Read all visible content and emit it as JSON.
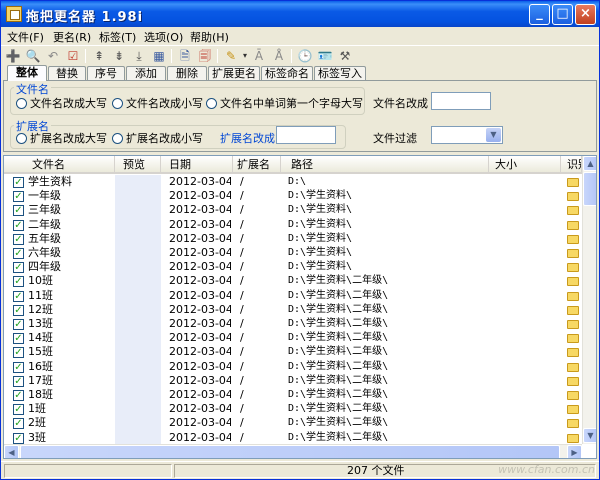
{
  "window": {
    "title": "拖把更名器 1.98i",
    "buttons": {
      "minimize": "_",
      "maximize": "□",
      "close": "×"
    }
  },
  "menu": [
    "文件(F)",
    "更名(R)",
    "标签(T)",
    "选项(O)",
    "帮助(H)"
  ],
  "toolbar": {
    "icons": [
      "add-folder-icon",
      "search-icon",
      "undo-icon",
      "checklist-icon",
      "move-up-icon",
      "move-down-icon",
      "move-bottom-icon",
      "grid-icon",
      "document-icon",
      "redo-document-icon",
      "edit-icon",
      "bold-a-icon",
      "clear-a-icon",
      "clock-icon",
      "id-card-icon",
      "tools-icon"
    ]
  },
  "tabs": [
    "整体",
    "替换",
    "序号",
    "添加",
    "删除",
    "扩展更名",
    "标签命名",
    "标签写入"
  ],
  "filename_group": {
    "label": "文件名",
    "options": [
      "文件名改成大写",
      "文件名改成小写",
      "文件名中单词第一个字母大写"
    ],
    "rename_label": "文件名改成"
  },
  "extension_group": {
    "label": "扩展名",
    "options": [
      "扩展名改成大写",
      "扩展名改成小写"
    ],
    "rename_label": "扩展名改成"
  },
  "file_filter_label": "文件过滤",
  "columns": [
    "文件名",
    "预览",
    "日期",
    "扩展名",
    "路径",
    "大小",
    "识别"
  ],
  "files": [
    {
      "name": "学生资料",
      "date": "2012-03-04",
      "ext": "/",
      "path": "D:\\"
    },
    {
      "name": "一年级",
      "date": "2012-03-04",
      "ext": "/",
      "path": "D:\\学生资料\\"
    },
    {
      "name": "三年级",
      "date": "2012-03-04",
      "ext": "/",
      "path": "D:\\学生资料\\"
    },
    {
      "name": "二年级",
      "date": "2012-03-04",
      "ext": "/",
      "path": "D:\\学生资料\\"
    },
    {
      "name": "五年级",
      "date": "2012-03-04",
      "ext": "/",
      "path": "D:\\学生资料\\"
    },
    {
      "name": "六年级",
      "date": "2012-03-04",
      "ext": "/",
      "path": "D:\\学生资料\\"
    },
    {
      "name": "四年级",
      "date": "2012-03-04",
      "ext": "/",
      "path": "D:\\学生资料\\"
    },
    {
      "name": "10班",
      "date": "2012-03-04",
      "ext": "/",
      "path": "D:\\学生资料\\二年级\\"
    },
    {
      "name": "11班",
      "date": "2012-03-04",
      "ext": "/",
      "path": "D:\\学生资料\\二年级\\"
    },
    {
      "name": "12班",
      "date": "2012-03-04",
      "ext": "/",
      "path": "D:\\学生资料\\二年级\\"
    },
    {
      "name": "13班",
      "date": "2012-03-04",
      "ext": "/",
      "path": "D:\\学生资料\\二年级\\"
    },
    {
      "name": "14班",
      "date": "2012-03-04",
      "ext": "/",
      "path": "D:\\学生资料\\二年级\\"
    },
    {
      "name": "15班",
      "date": "2012-03-04",
      "ext": "/",
      "path": "D:\\学生资料\\二年级\\"
    },
    {
      "name": "16班",
      "date": "2012-03-04",
      "ext": "/",
      "path": "D:\\学生资料\\二年级\\"
    },
    {
      "name": "17班",
      "date": "2012-03-04",
      "ext": "/",
      "path": "D:\\学生资料\\二年级\\"
    },
    {
      "name": "18班",
      "date": "2012-03-04",
      "ext": "/",
      "path": "D:\\学生资料\\二年级\\"
    },
    {
      "name": "1班",
      "date": "2012-03-04",
      "ext": "/",
      "path": "D:\\学生资料\\二年级\\"
    },
    {
      "name": "2班",
      "date": "2012-03-04",
      "ext": "/",
      "path": "D:\\学生资料\\二年级\\"
    },
    {
      "name": "3班",
      "date": "2012-03-04",
      "ext": "/",
      "path": "D:\\学生资料\\二年级\\"
    }
  ],
  "status": {
    "count": "207 个文件",
    "watermark": "www.cfan.com.cn"
  }
}
